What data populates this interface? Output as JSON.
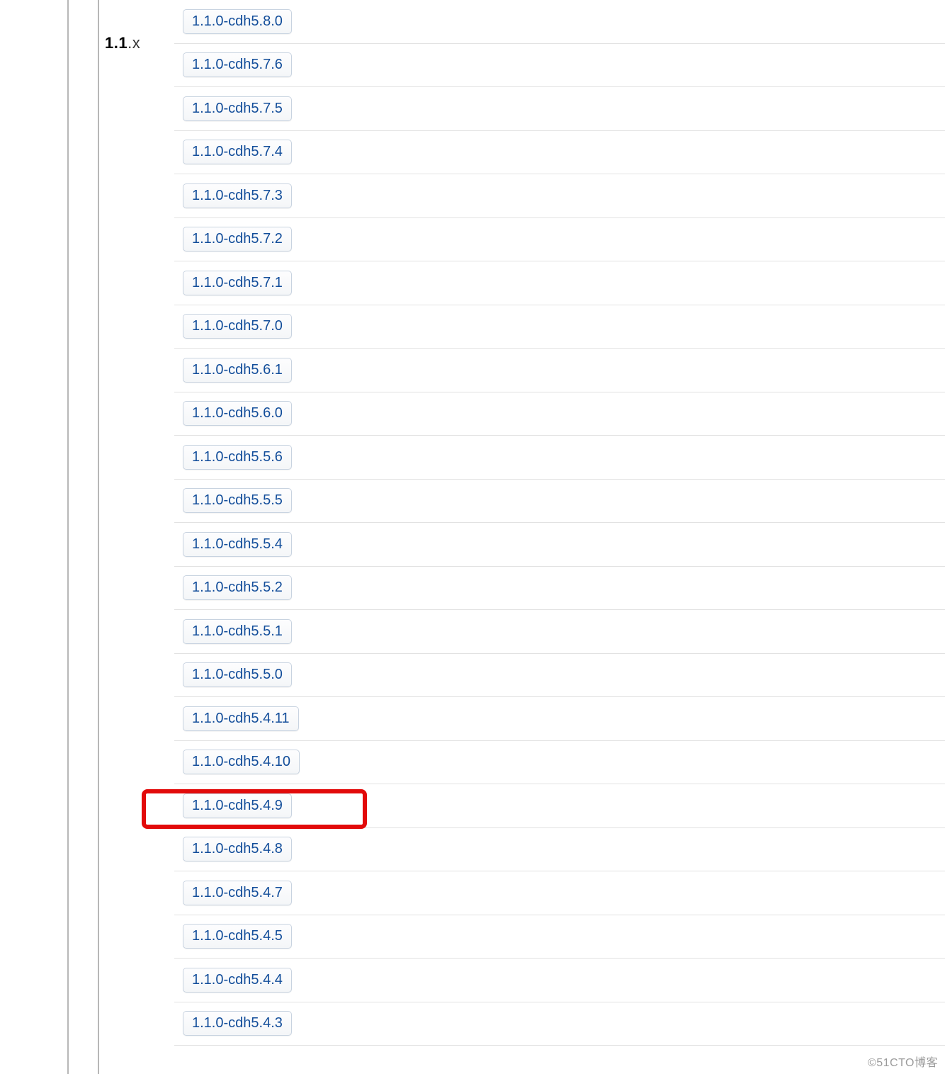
{
  "group": {
    "label_bold": "1.1",
    "label_suffix": ".x"
  },
  "versions": [
    {
      "label": "1.1.0-cdh5.8.0",
      "highlight": false
    },
    {
      "label": "1.1.0-cdh5.7.6",
      "highlight": false
    },
    {
      "label": "1.1.0-cdh5.7.5",
      "highlight": false
    },
    {
      "label": "1.1.0-cdh5.7.4",
      "highlight": false
    },
    {
      "label": "1.1.0-cdh5.7.3",
      "highlight": false
    },
    {
      "label": "1.1.0-cdh5.7.2",
      "highlight": false
    },
    {
      "label": "1.1.0-cdh5.7.1",
      "highlight": false
    },
    {
      "label": "1.1.0-cdh5.7.0",
      "highlight": false
    },
    {
      "label": "1.1.0-cdh5.6.1",
      "highlight": false
    },
    {
      "label": "1.1.0-cdh5.6.0",
      "highlight": false
    },
    {
      "label": "1.1.0-cdh5.5.6",
      "highlight": false
    },
    {
      "label": "1.1.0-cdh5.5.5",
      "highlight": false
    },
    {
      "label": "1.1.0-cdh5.5.4",
      "highlight": false
    },
    {
      "label": "1.1.0-cdh5.5.2",
      "highlight": false
    },
    {
      "label": "1.1.0-cdh5.5.1",
      "highlight": false
    },
    {
      "label": "1.1.0-cdh5.5.0",
      "highlight": false
    },
    {
      "label": "1.1.0-cdh5.4.11",
      "highlight": false
    },
    {
      "label": "1.1.0-cdh5.4.10",
      "highlight": false
    },
    {
      "label": "1.1.0-cdh5.4.9",
      "highlight": true
    },
    {
      "label": "1.1.0-cdh5.4.8",
      "highlight": false
    },
    {
      "label": "1.1.0-cdh5.4.7",
      "highlight": false
    },
    {
      "label": "1.1.0-cdh5.4.5",
      "highlight": false
    },
    {
      "label": "1.1.0-cdh5.4.4",
      "highlight": false
    },
    {
      "label": "1.1.0-cdh5.4.3",
      "highlight": false
    }
  ],
  "watermark": "©51CTO博客"
}
